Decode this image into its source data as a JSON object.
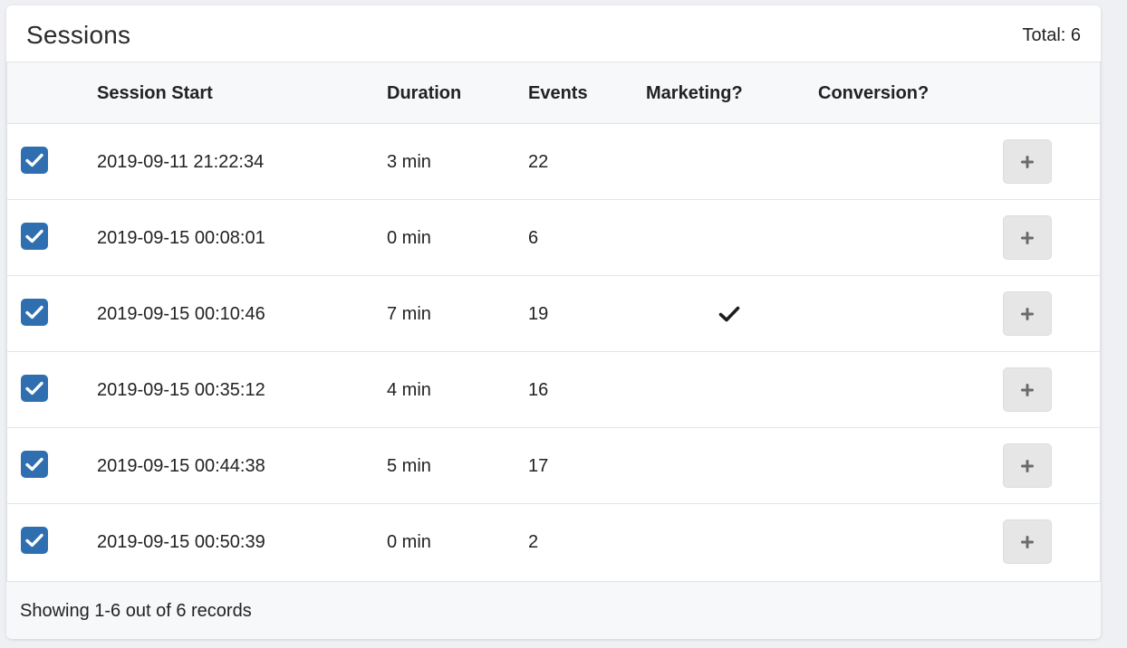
{
  "header": {
    "title": "Sessions",
    "total": "Total: 6"
  },
  "table": {
    "columns": {
      "session_start": "Session Start",
      "duration": "Duration",
      "events": "Events",
      "marketing": "Marketing?",
      "conversion": "Conversion?"
    },
    "rows": [
      {
        "checked": true,
        "session_start": "2019-09-11 21:22:34",
        "duration": "3 min",
        "events": "22",
        "marketing": false,
        "conversion": false
      },
      {
        "checked": true,
        "session_start": "2019-09-15 00:08:01",
        "duration": "0 min",
        "events": "6",
        "marketing": false,
        "conversion": false
      },
      {
        "checked": true,
        "session_start": "2019-09-15 00:10:46",
        "duration": "7 min",
        "events": "19",
        "marketing": true,
        "conversion": false
      },
      {
        "checked": true,
        "session_start": "2019-09-15 00:35:12",
        "duration": "4 min",
        "events": "16",
        "marketing": false,
        "conversion": false
      },
      {
        "checked": true,
        "session_start": "2019-09-15 00:44:38",
        "duration": "5 min",
        "events": "17",
        "marketing": false,
        "conversion": false
      },
      {
        "checked": true,
        "session_start": "2019-09-15 00:50:39",
        "duration": "0 min",
        "events": "2",
        "marketing": false,
        "conversion": false
      }
    ]
  },
  "footer": {
    "text": "Showing 1-6 out of 6 records"
  },
  "icons": {
    "checkbox": "checkbox-checked-icon",
    "marketing": "check-icon",
    "expand": "plus-icon"
  },
  "colors": {
    "checkbox": "#2f6fb0",
    "plus_button_bg": "#e6e6e6",
    "header_bg": "#f7f8fa"
  }
}
